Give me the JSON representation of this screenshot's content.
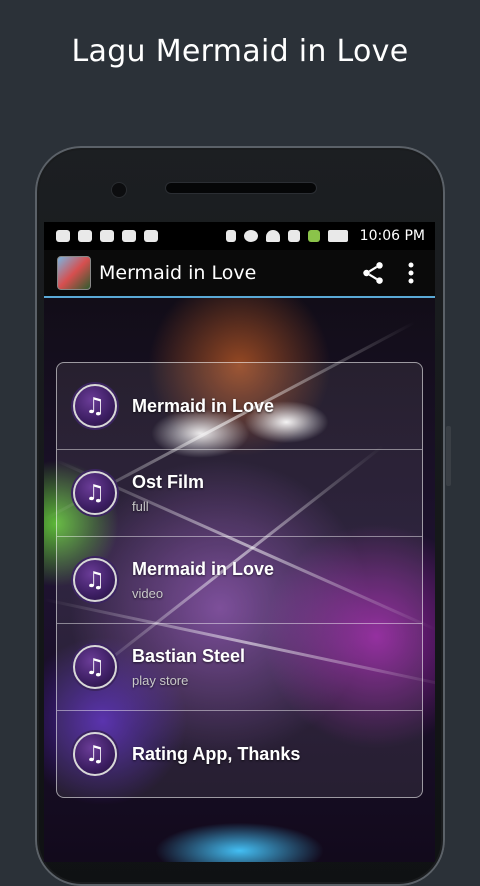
{
  "promo": {
    "title": "Lagu Mermaid in Love"
  },
  "statusbar": {
    "time": "10:06 PM"
  },
  "appbar": {
    "title": "Mermaid in Love",
    "share_icon": "share-icon",
    "menu_icon": "overflow-menu-icon"
  },
  "menu": {
    "items": [
      {
        "title": "Mermaid in Love",
        "subtitle": "",
        "icon": "music-note-icon"
      },
      {
        "title": "Ost Film",
        "subtitle": "full",
        "icon": "music-note-icon"
      },
      {
        "title": "Mermaid in Love",
        "subtitle": "video",
        "icon": "music-note-icon"
      },
      {
        "title": "Bastian Steel",
        "subtitle": "play store",
        "icon": "music-note-icon"
      },
      {
        "title": "Rating App, Thanks",
        "subtitle": "",
        "icon": "music-note-icon"
      }
    ]
  },
  "colors": {
    "accent_line": "#5aa9d6",
    "background": "#2b3138"
  }
}
